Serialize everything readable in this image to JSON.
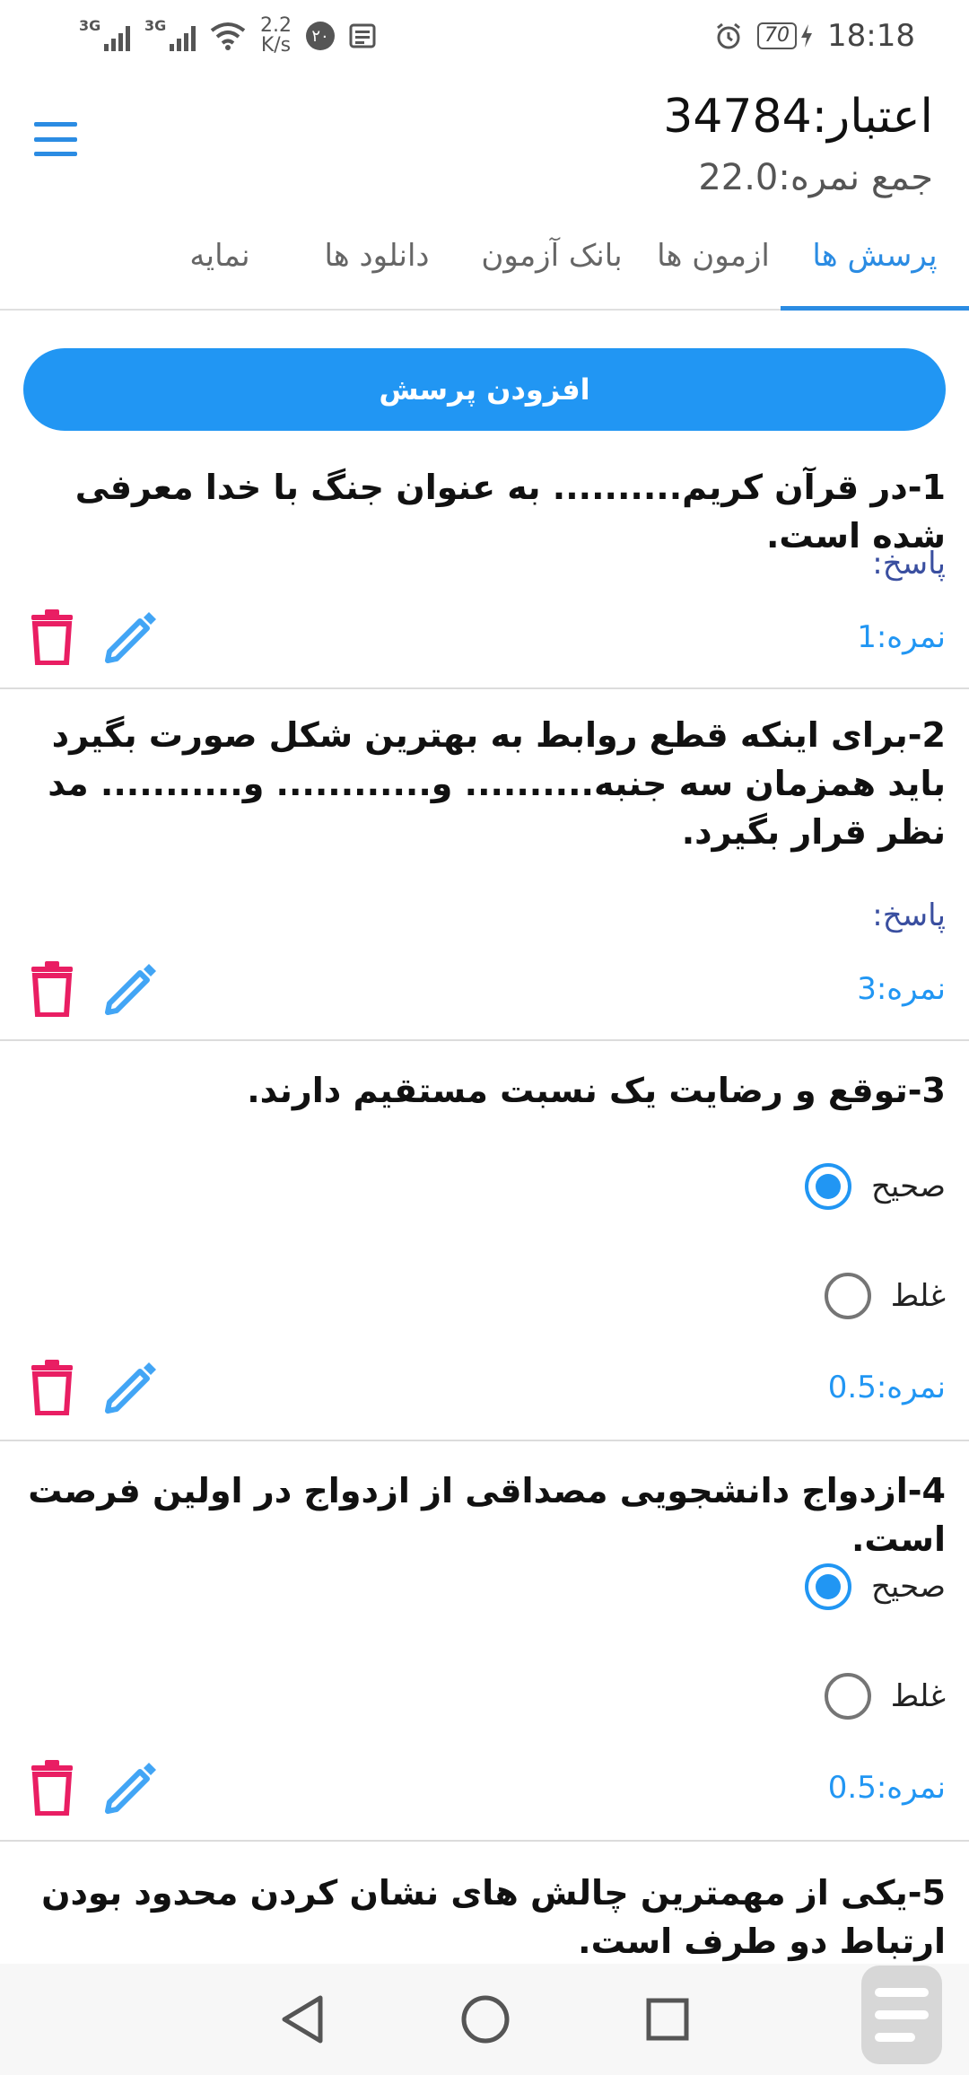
{
  "status_bar": {
    "net1": "3G",
    "net2": "3G",
    "speed_value": "2.2",
    "speed_unit": "K/s",
    "notif_count": "۲۰",
    "battery": "70",
    "time": "18:18"
  },
  "header": {
    "credit": "اعتبار:34784",
    "total_score": "جمع نمره:22.0"
  },
  "tabs": [
    {
      "label": "پرسش ها",
      "active": true
    },
    {
      "label": "ازمون ها",
      "active": false
    },
    {
      "label": "بانک آزمون",
      "active": false
    },
    {
      "label": "دانلود ها",
      "active": false
    },
    {
      "label": "نمایه",
      "active": false
    }
  ],
  "add_question_label": "افزودن پرسش",
  "questions": [
    {
      "text": "1-در قرآن کریم.......... به عنوان جنگ با خدا معرفی شده است.",
      "answer_label": "پاسخ:",
      "score": "نمره:1"
    },
    {
      "text": "2-برای اینکه قطع روابط به بهترین شکل صورت بگیرد باید همزمان سه جنبه.......... و............ و........... مد نظر قرار بگیرد.",
      "answer_label": "پاسخ:",
      "score": "نمره:3"
    },
    {
      "text": "3-توقع و رضایت یک نسبت مستقیم دارند.",
      "options": [
        {
          "label": "صحیح",
          "checked": true
        },
        {
          "label": "غلط",
          "checked": false
        }
      ],
      "score": "نمره:0.5"
    },
    {
      "text": "4-ازدواج دانشجویی مصداقی از ازدواج در اولین فرصت است.",
      "options": [
        {
          "label": "صحیح",
          "checked": true
        },
        {
          "label": "غلط",
          "checked": false
        }
      ],
      "score": "نمره:0.5"
    },
    {
      "text": "5-یکی از مهمترین چالش های نشان کردن محدود بودن ارتباط دو طرف است."
    }
  ],
  "colors": {
    "accent": "#2196f3",
    "delete": "#e91e63",
    "edit": "#42a5f5"
  }
}
